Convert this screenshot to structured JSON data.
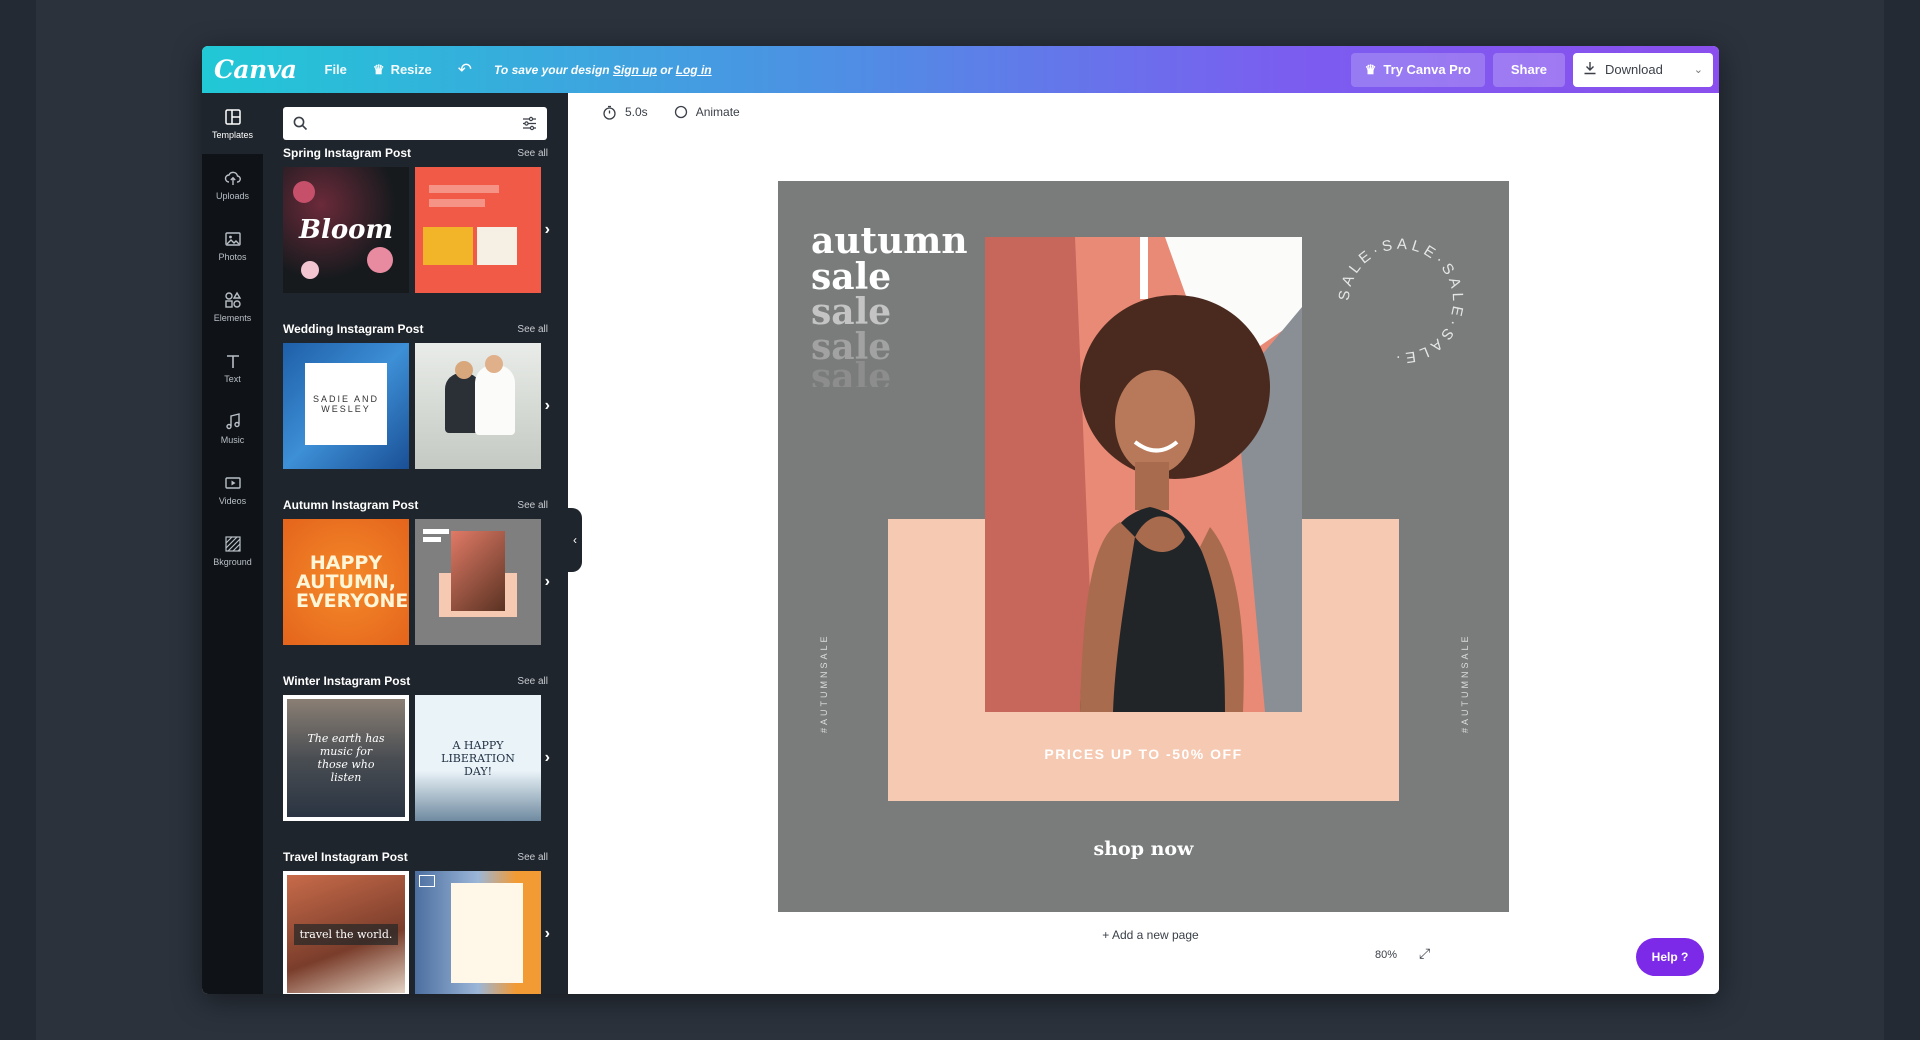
{
  "topbar": {
    "logo": "Canva",
    "file": "File",
    "resize": "Resize",
    "save_prefix": "To save your design",
    "sign_up": "Sign up",
    "or": "or",
    "log_in": "Log in",
    "try_pro": "Try Canva Pro",
    "share": "Share",
    "download": "Download"
  },
  "rail": {
    "items": [
      {
        "label": "Templates",
        "icon": "templates-icon"
      },
      {
        "label": "Uploads",
        "icon": "upload-cloud-icon"
      },
      {
        "label": "Photos",
        "icon": "photo-icon"
      },
      {
        "label": "Elements",
        "icon": "shapes-icon"
      },
      {
        "label": "Text",
        "icon": "text-icon"
      },
      {
        "label": "Music",
        "icon": "music-note-icon"
      },
      {
        "label": "Videos",
        "icon": "video-icon"
      },
      {
        "label": "Bkground",
        "icon": "background-stripes-icon"
      }
    ]
  },
  "panel": {
    "search_placeholder": "",
    "sections": [
      {
        "title": "Spring Instagram Post",
        "see_all": "See all",
        "thumb1_text": "Bloom"
      },
      {
        "title": "Wedding Instagram Post",
        "see_all": "See all",
        "thumb1_text": "SADIE AND WESLEY"
      },
      {
        "title": "Autumn Instagram Post",
        "see_all": "See all",
        "thumb1_text": "HAPPY AUTUMN, EVERYONE!"
      },
      {
        "title": "Winter Instagram Post",
        "see_all": "See all",
        "thumb1_text": "The earth has music for those who listen",
        "thumb2_text": "A HAPPY LIBERATION DAY!"
      },
      {
        "title": "Travel Instagram Post",
        "see_all": "See all",
        "thumb1_text": "travel the world."
      }
    ]
  },
  "editor": {
    "duration": "5.0s",
    "animate": "Animate",
    "add_page": "+ Add a new page",
    "zoom": "80%",
    "help": "Help ?"
  },
  "design": {
    "line1": "autumn",
    "line2": "sale",
    "line3": "sale",
    "line4": "sale",
    "line5": "sale",
    "price_text": "PRICES UP TO -50% OFF",
    "shop_now": "shop now",
    "vertical_text": "#AUTUMNSALE",
    "ring_text": "SALE·SALE·SALE·SALE·",
    "bg_color": "#7a7c7c",
    "peach_color": "#f6c9b2"
  },
  "colors": {
    "accent": "#7d2ae8",
    "gradient_start": "#21c8d6",
    "gradient_end": "#8a4fee"
  }
}
